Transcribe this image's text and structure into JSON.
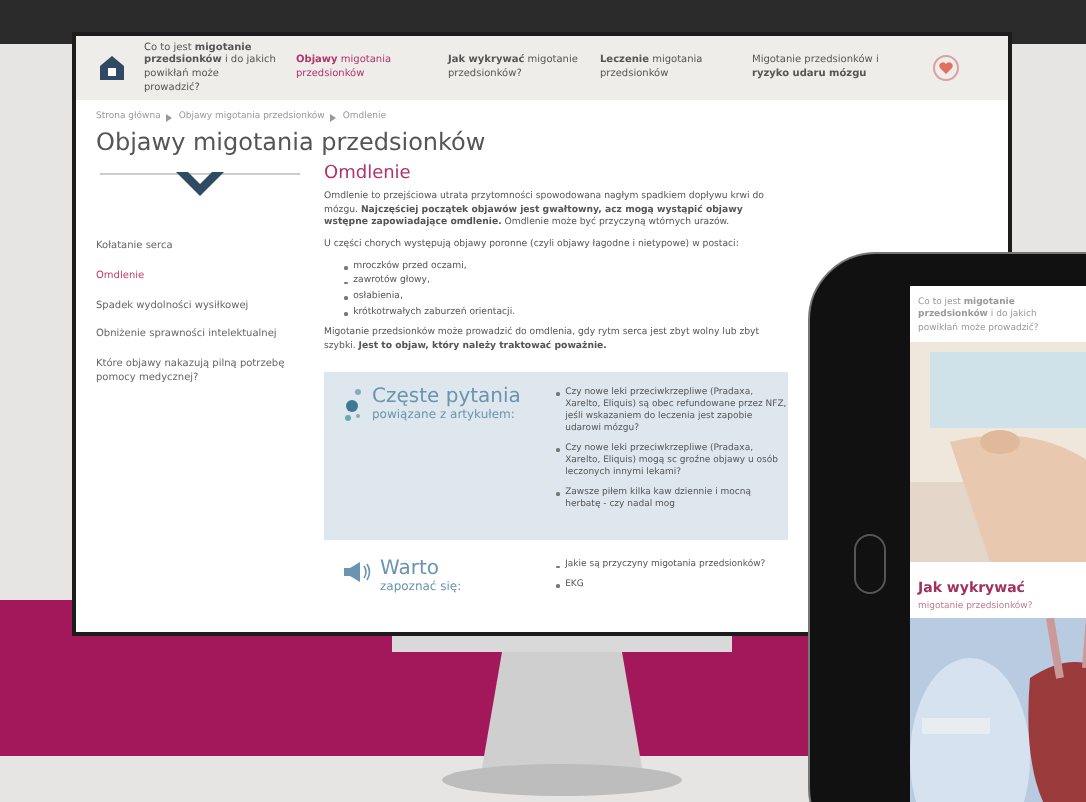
{
  "monitor": {
    "nav": [
      {
        "text": "Co to jest **migotanie przedsionków** i do jakich powikłań może prowadzić?",
        "selected": false
      },
      {
        "text": "**Objawy** migotania przedsionków",
        "selected": true
      },
      {
        "text": "**Jak wykrywać** migotanie przedsionków?",
        "selected": false
      },
      {
        "text": "**Leczenie** migotania przedsionków",
        "selected": false
      },
      {
        "text": "Migotanie przedsionków i **ryzyko udaru mózgu**",
        "selected": false
      }
    ],
    "breadcrumb": [
      "Strona główna",
      "Objawy migotania przedsionków",
      "Omdlenie"
    ],
    "title": "Objawy migotania przedsionków",
    "sidebar": [
      {
        "label": "Kołatanie serca",
        "selected": false
      },
      {
        "label": "Omdlenie",
        "selected": true
      },
      {
        "label": "Spadek wydolności wysiłkowej",
        "selected": false
      },
      {
        "label": "Obniżenie sprawności intelektualnej",
        "selected": false
      },
      {
        "label": "Które objawy nakazują pilną potrzebę pomocy medycznej?",
        "selected": false
      }
    ],
    "article": {
      "heading": "Omdlenie",
      "paragraphs": [
        "Omdlenie to przejściowa utrata przytomności spowodowana nagłym spadkiem dopływu krwi do mózgu. **Najczęściej początek objawów jest gwałtowny, acz mogą wystąpić objawy wstępne zapowiadające omdlenie.** Omdlenie może być przyczyną wtórnych urazów.",
        "U części chorych występują objawy poronne (czyli objawy łagodne i nietypowe) w postaci:"
      ],
      "list": [
        "mroczków przed oczami,",
        "zawrotów głowy,",
        "osłabienia,",
        "krótkotrwałych zaburzeń orientacji."
      ],
      "closing": "Migotanie przedsionków może prowadzić do omdlenia, gdy rytm serca jest zbyt wolny lub zbyt szybki. **Jest to objaw, który należy traktować poważnie.**"
    },
    "faq": {
      "title": "Częste pytania",
      "subtitle": "powiązane z artykułem:",
      "questions": [
        "Czy nowe leki przeciwkrzepliwe (Pradaxa, Xarelto, Eliquis) są obec refundowane przez NFZ, jeśli wskazaniem do leczenia jest zapobie udarowi mózgu?",
        "Czy nowe leki przeciwkrzepliwe (Pradaxa, Xarelto, Eliquis) mogą sc groźne objawy u osób leczonych innymi lekami?",
        "Zawsze piłem kilka kaw dziennie i mocną herbatę - czy nadal mog"
      ]
    },
    "see_also": {
      "title": "Warto",
      "subtitle": "zapoznać się:",
      "links": [
        "Jakie są przyczyny migotania przedsionków?",
        "EKG"
      ]
    }
  },
  "tablet": {
    "header": "Co to jest **migotanie przedsionków** i do jakich powikłań może prowadzić?",
    "heading": "Jak wykrywać",
    "subheading": "migotanie przedsionków?"
  }
}
